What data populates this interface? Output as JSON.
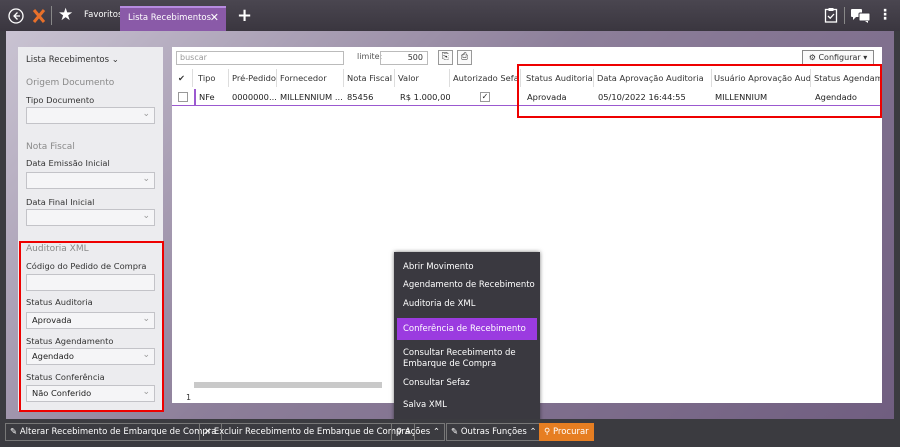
{
  "topbar": {
    "back_icon": "back-circle-icon",
    "logo_icon": "star-logo-icon",
    "favorites_label": "Favoritos -",
    "active_tab_label": "Lista Recebimentos",
    "close_glyph": "✕",
    "add_glyph": "+"
  },
  "filters": {
    "title": "Lista Recebimentos",
    "origem_section": "Origem Documento",
    "tipo_documento_label": "Tipo Documento",
    "tipo_documento_value": "",
    "nota_fiscal_section": "Nota Fiscal",
    "data_emissao_label": "Data Emissão Inicial",
    "data_emissao_value": "",
    "data_final_label": "Data Final Inicial",
    "data_final_value": "",
    "auditoria_section": "Auditoria XML",
    "codigo_pedido_label": "Código do Pedido de Compra",
    "codigo_pedido_value": "",
    "status_auditoria_label": "Status Auditoria",
    "status_auditoria_value": "Aprovada",
    "status_agendamento_label": "Status Agendamento",
    "status_agendamento_value": "Agendado",
    "status_conferencia_label": "Status Conferência",
    "status_conferencia_value": "Não Conferido"
  },
  "toolbar": {
    "search_placeholder": "buscar",
    "limit_label": "limite:",
    "limit_value": "500",
    "configure_label": "⚙ Configurar ▾"
  },
  "grid": {
    "headers": [
      "✔",
      "Tipo",
      "Pré-Pedido",
      "Fornecedor",
      "Nota Fiscal",
      "Valor",
      "Autorizado Sefaz",
      "Status Auditoria",
      "Data Aprovação Auditoria",
      "Usuário Aprovação Auditoria",
      "Status Agendame"
    ],
    "rows": [
      {
        "tipo": "NFe",
        "pre_pedido": "0000000...",
        "fornecedor": "MILLENNIUM ...",
        "nota_fiscal": "85456",
        "valor": "R$ 1.000,00",
        "autorizado_sefaz": true,
        "status_auditoria": "Aprovada",
        "data_aprovacao": "05/10/2022 16:44:55",
        "usuario_aprovacao": "MILLENNIUM",
        "status_agendamento": "Agendado"
      }
    ],
    "page": "1"
  },
  "actions_menu": {
    "items": [
      "Abrir Movimento",
      "Agendamento de Recebimento",
      "Auditoria de XML",
      "Conferência de Recebimento",
      "Consultar Recebimento de",
      "Embarque de Compra",
      "Consultar Sefaz",
      "Salva XML"
    ],
    "highlighted": "Conferência de Recebimento"
  },
  "bottombar": {
    "alterar": "Alterar Recebimento de Embarque de Compra",
    "excluir": "Excluir Recebimento de Embarque de Compra",
    "acoes": "Ações",
    "outras": "Outras Funções",
    "procurar": "Procurar"
  },
  "colors": {
    "accent": "#9b3be0",
    "highlight_box": "#ee0000",
    "search_button": "#e67e22"
  }
}
